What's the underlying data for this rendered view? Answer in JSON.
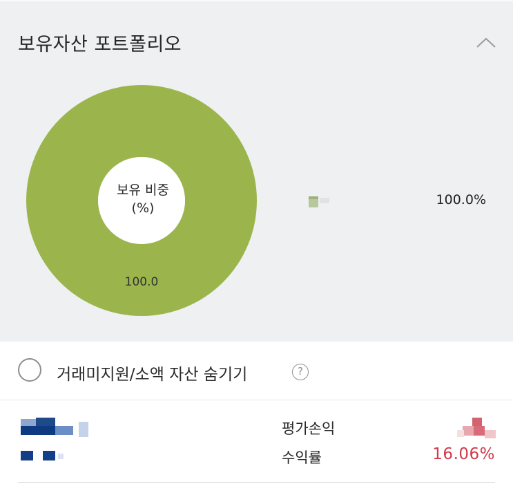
{
  "portfolio": {
    "title": "보유자산 포트폴리오",
    "collapse_icon": "chevron-up-icon",
    "chart_data": {
      "type": "pie",
      "categories": [
        ""
      ],
      "values": [
        100.0
      ],
      "colors": [
        "#9bb54c"
      ],
      "title": "",
      "center_label": "보유 비중\n(%)",
      "data_labels": [
        "100.0"
      ]
    },
    "center_line1": "보유 비중",
    "center_line2": "(%)",
    "slice_label": "100.0",
    "legend": {
      "swatch_color": "#b9c79c",
      "value": "100.0%"
    }
  },
  "filter": {
    "label": "거래미지원/소액 자산 숨기기",
    "checked": false,
    "help_icon": "question-circle-icon",
    "help_glyph": "?"
  },
  "asset": {
    "eval_label": "평가손익",
    "return_label": "수익률",
    "return_value": "16.06%",
    "accent_color": "#d13a4a"
  }
}
